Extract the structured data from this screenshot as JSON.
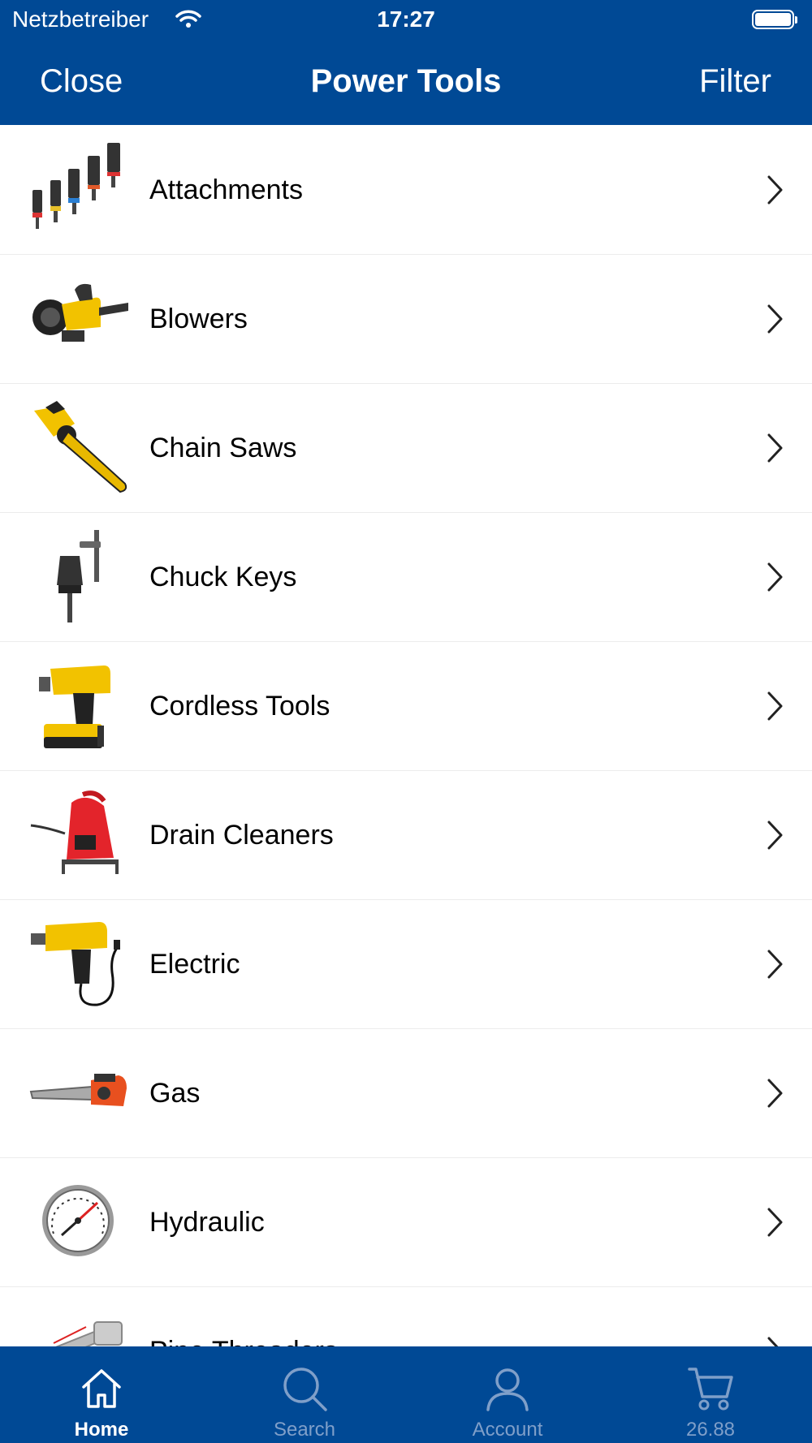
{
  "status_bar": {
    "carrier": "Netzbetreiber",
    "time": "17:27"
  },
  "nav": {
    "close_label": "Close",
    "title": "Power Tools",
    "filter_label": "Filter"
  },
  "categories": [
    {
      "label": "Attachments",
      "icon": "socket-set-icon"
    },
    {
      "label": "Blowers",
      "icon": "leaf-blower-icon"
    },
    {
      "label": "Chain Saws",
      "icon": "chain-saw-icon"
    },
    {
      "label": "Chuck Keys",
      "icon": "chuck-key-icon"
    },
    {
      "label": "Cordless Tools",
      "icon": "cordless-drill-icon"
    },
    {
      "label": "Drain Cleaners",
      "icon": "drain-cleaner-icon"
    },
    {
      "label": "Electric",
      "icon": "impact-wrench-icon"
    },
    {
      "label": "Gas",
      "icon": "gas-chainsaw-icon"
    },
    {
      "label": "Hydraulic",
      "icon": "pressure-gauge-icon"
    },
    {
      "label": "Pipe Threaders",
      "icon": "pipe-threader-icon"
    }
  ],
  "tabbar": {
    "home": "Home",
    "search": "Search",
    "account": "Account",
    "cart": "26.88"
  },
  "colors": {
    "brand": "#004995",
    "inactive_tab": "#7f9fc9"
  }
}
